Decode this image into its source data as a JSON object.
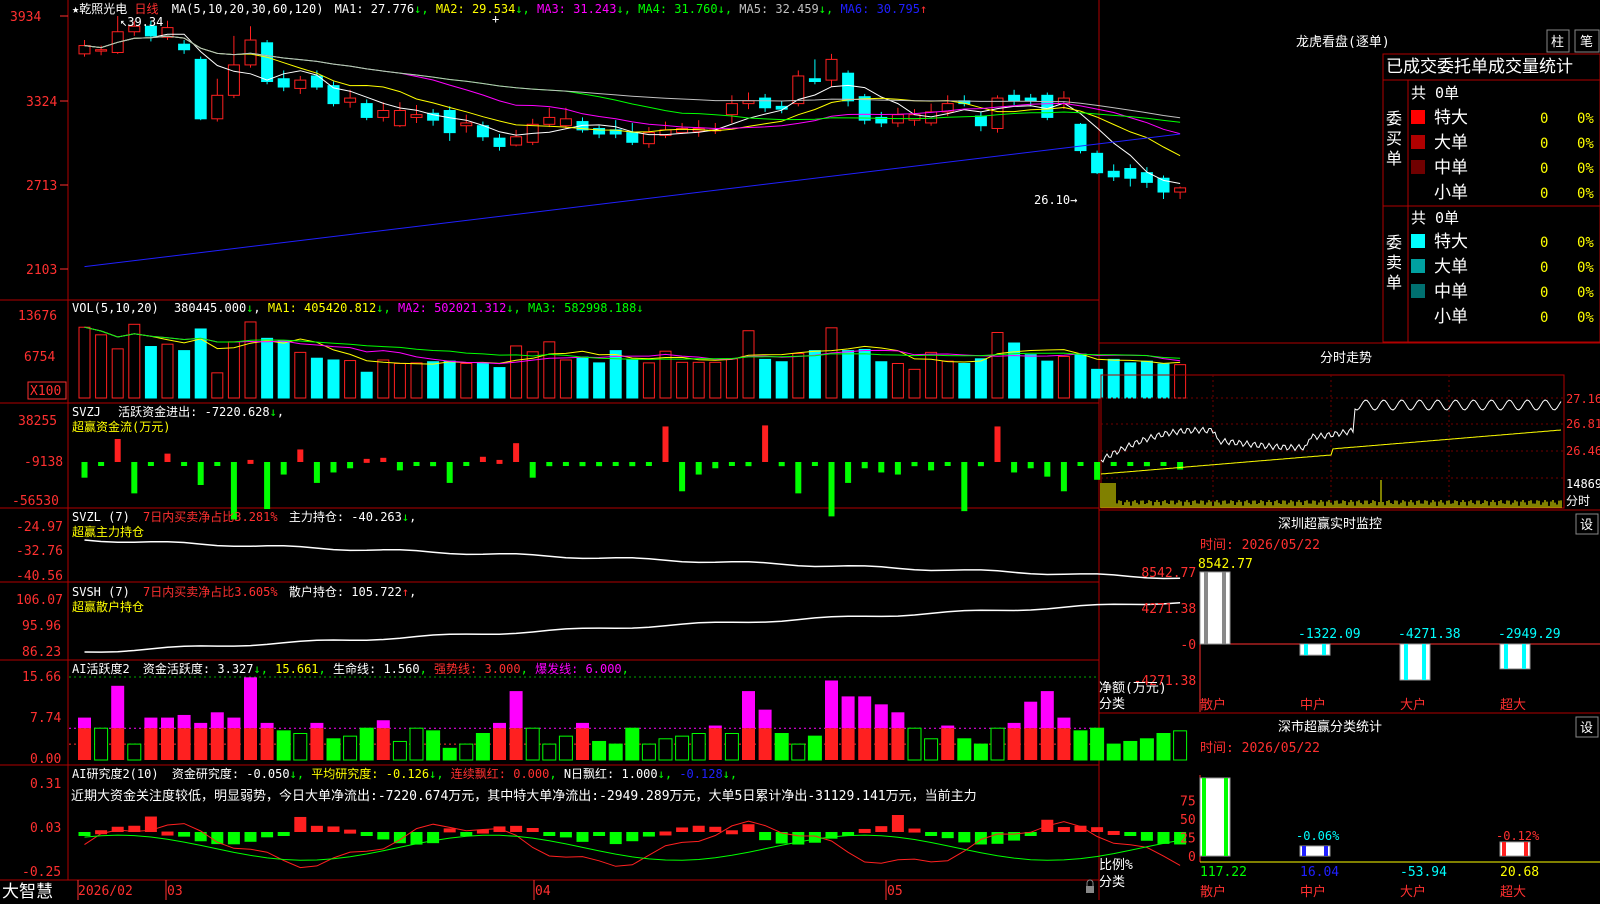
{
  "stock_title": "★乾照光电",
  "period": "日线",
  "candle_panel": {
    "ma_prefix": "MA(5,10,20,30,60,120)",
    "ma": [
      {
        "label": "MA1: 27.776",
        "arrow": "↓",
        "color": "#ffffff"
      },
      {
        "label": "MA2: 29.534",
        "arrow": "↓",
        "color": "#ffff00"
      },
      {
        "label": "MA3: 31.243",
        "arrow": "↓",
        "color": "#ff00ff"
      },
      {
        "label": "MA4: 31.760",
        "arrow": "↓",
        "color": "#00ff00"
      },
      {
        "label": "MA5: 32.459",
        "arrow": "↓",
        "color": "#c0c0c0"
      },
      {
        "label": "MA6: 30.795",
        "arrow": "↑",
        "color": "#2020ff"
      }
    ],
    "y_ticks": [
      "3934",
      "3324",
      "2713",
      "2103"
    ],
    "high_label": "39.34",
    "low_label": "26.10"
  },
  "vol_panel": {
    "title": "VOL(5,10,20)",
    "value": "380445.000",
    "ma": [
      {
        "label": "MA1: 405420.812",
        "color": "#ffff00"
      },
      {
        "label": "MA2: 502021.312",
        "color": "#ff00ff"
      },
      {
        "label": "MA3: 582998.188",
        "color": "#00ff00"
      }
    ],
    "y_ticks": [
      "13676",
      "6754"
    ],
    "unit": "X100"
  },
  "svzj_panel": {
    "title": "SVZJ",
    "label": "活跃资金进出: -7220.628",
    "subtitle": "超赢资金流(万元)",
    "y_ticks": [
      "38255",
      "-9138",
      "-56530"
    ]
  },
  "svzl_panel": {
    "title": "SVZL (7)",
    "ratio": "7日内买卖净占比3.281%",
    "label": "主力持仓: -40.263",
    "subtitle": "超赢主力持仓",
    "y_ticks": [
      "-24.97",
      "-32.76",
      "-40.56"
    ]
  },
  "svsh_panel": {
    "title": "SVSH (7)",
    "ratio": "7日内买卖净占比3.605%",
    "label": "散户持仓: 105.722",
    "subtitle": "超赢散户持仓",
    "y_ticks": [
      "106.07",
      "95.96",
      "86.23"
    ]
  },
  "ai_active_panel": {
    "title": "AI活跃度2",
    "items": [
      {
        "label": "资金活跃度: 3.327",
        "arrow": "↓",
        "color": "#ffffff"
      },
      {
        "label": "15.661",
        "arrow": "",
        "color": "#ffff00"
      },
      {
        "label": "生命线: 1.560",
        "arrow": "",
        "color": "#ffffff"
      },
      {
        "label": "强势线: 3.000",
        "arrow": "",
        "color": "#ff3030"
      },
      {
        "label": "爆发线: 6.000",
        "arrow": "",
        "color": "#ff00ff"
      }
    ],
    "y_ticks": [
      "15.66",
      "7.74",
      "0.00"
    ]
  },
  "ai_research_panel": {
    "title": "AI研究度2(10)",
    "items": [
      {
        "label": "资金研究度: -0.050",
        "arrow": "↓",
        "color": "#ffffff"
      },
      {
        "label": "平均研究度: -0.126",
        "arrow": "↓",
        "color": "#ffff00"
      },
      {
        "label": "连续飘红: 0.000",
        "arrow": "",
        "color": "#ff3030"
      },
      {
        "label": "N日飘红: 1.000",
        "arrow": "↓",
        "color": "#ffffff"
      },
      {
        "label": "-0.128",
        "arrow": "↓",
        "color": "#2020ff"
      }
    ],
    "comment": "近期大资金关注度较低，明显弱势，今日大单净流出:-7220.674万元，其中特大单净流出:-2949.289万元，大单5日累计净出-31129.141万元，当前主力",
    "y_ticks": [
      "0.31",
      "0.03",
      "-0.25"
    ]
  },
  "bottom_bar": {
    "brand": "大智慧",
    "dates": [
      "2026/02",
      "03",
      "04",
      "05"
    ]
  },
  "right": {
    "dragon": {
      "title": "龙虎看盘(逐单)",
      "tab_bar": "柱",
      "tab_single": "笔",
      "heading": "已成交委托单成交量统计",
      "buy_label": "委买单",
      "sell_label": "委卖单",
      "buy_total": "共 0单",
      "sell_total": "共 0单",
      "buy_rows": [
        {
          "name": "特大",
          "count": "0",
          "pct": "0%",
          "color": "#ff0000"
        },
        {
          "name": "大单",
          "count": "0",
          "pct": "0%",
          "color": "#b00000"
        },
        {
          "name": "中单",
          "count": "0",
          "pct": "0%",
          "color": "#700000"
        },
        {
          "name": "小单",
          "count": "0",
          "pct": "0%",
          "color": ""
        }
      ],
      "sell_rows": [
        {
          "name": "特大",
          "count": "0",
          "pct": "0%",
          "color": "#00ffff"
        },
        {
          "name": "大单",
          "count": "0",
          "pct": "0%",
          "color": "#00a0a0"
        },
        {
          "name": "中单",
          "count": "0",
          "pct": "0%",
          "color": "#007070"
        },
        {
          "name": "小单",
          "count": "0",
          "pct": "0%",
          "color": ""
        }
      ]
    },
    "intraday": {
      "title": "分时走势",
      "y_ticks": [
        "27.16",
        "26.81",
        "26.46"
      ],
      "vol_tick": "14869",
      "vol_unit": "分时"
    },
    "monitor": {
      "title": "深圳超赢实时监控",
      "settings": "设",
      "date": "时间: 2026/05/22",
      "y_ticks": [
        "8542.77",
        "4271.38",
        "-0",
        "-4271.38"
      ],
      "axis_label": "净额(万元)",
      "cat_label": "分类",
      "categories": [
        "散户",
        "中户",
        "大户",
        "超大"
      ],
      "values": [
        8542.77,
        -1322.09,
        -4271.38,
        -2949.29
      ],
      "value_labels": [
        "8542.77",
        "-1322.09",
        "-4271.38",
        "-2949.29"
      ]
    },
    "stats": {
      "title": "深市超赢分类统计",
      "settings": "设",
      "date": "时间: 2026/05/22",
      "y_ticks": [
        "75",
        "50",
        "25",
        "0"
      ],
      "axis_label": "比例%",
      "cat_label": "分类",
      "categories": [
        "散户",
        "中户",
        "大户",
        "超大"
      ],
      "values": [
        117.22,
        16.04,
        -53.94,
        20.68
      ],
      "value_labels": [
        "117.22",
        "16.04",
        "-53.94",
        "20.68"
      ],
      "top_labels": [
        "",
        "-0.06%",
        "",
        "-0.12%"
      ]
    }
  },
  "chart_data": [
    {
      "type": "candlestick",
      "title": "乾照光电 日线",
      "x": [
        "2026/02",
        "03",
        "04",
        "05"
      ],
      "ylim": [
        21.03,
        39.34
      ],
      "high": 39.34,
      "low": 26.1,
      "candles": [
        {
          "o": 36.6,
          "c": 37.2,
          "h": 37.6,
          "l": 36.4
        },
        {
          "o": 36.8,
          "c": 36.9,
          "h": 37.2,
          "l": 36.5
        },
        {
          "o": 36.7,
          "c": 38.2,
          "h": 39.34,
          "l": 36.6
        },
        {
          "o": 38.2,
          "c": 38.6,
          "h": 39.0,
          "l": 37.9
        },
        {
          "o": 38.6,
          "c": 37.9,
          "h": 39.0,
          "l": 37.5
        },
        {
          "o": 37.8,
          "c": 38.5,
          "h": 39.0,
          "l": 37.6
        },
        {
          "o": 37.3,
          "c": 36.9,
          "h": 37.6,
          "l": 36.6
        },
        {
          "o": 36.2,
          "c": 31.9,
          "h": 36.4,
          "l": 31.8
        },
        {
          "o": 31.9,
          "c": 33.6,
          "h": 34.8,
          "l": 31.7
        },
        {
          "o": 33.6,
          "c": 35.8,
          "h": 37.9,
          "l": 33.4
        },
        {
          "o": 35.8,
          "c": 37.6,
          "h": 38.6,
          "l": 35.6
        },
        {
          "o": 37.4,
          "c": 34.6,
          "h": 37.6,
          "l": 34.4
        },
        {
          "o": 34.8,
          "c": 34.2,
          "h": 35.4,
          "l": 33.9
        },
        {
          "o": 34.1,
          "c": 34.7,
          "h": 35.0,
          "l": 33.7
        },
        {
          "o": 35.0,
          "c": 34.2,
          "h": 35.4,
          "l": 34.0
        },
        {
          "o": 34.3,
          "c": 33.0,
          "h": 34.6,
          "l": 32.8
        },
        {
          "o": 33.1,
          "c": 33.4,
          "h": 34.0,
          "l": 32.7
        },
        {
          "o": 33.0,
          "c": 32.0,
          "h": 33.3,
          "l": 31.8
        },
        {
          "o": 32.0,
          "c": 32.5,
          "h": 33.1,
          "l": 31.7
        },
        {
          "o": 31.4,
          "c": 32.5,
          "h": 33.1,
          "l": 31.3
        },
        {
          "o": 32.0,
          "c": 32.2,
          "h": 32.9,
          "l": 31.6
        },
        {
          "o": 32.3,
          "c": 31.8,
          "h": 32.6,
          "l": 31.4
        },
        {
          "o": 32.5,
          "c": 30.9,
          "h": 32.8,
          "l": 30.3
        },
        {
          "o": 31.4,
          "c": 31.6,
          "h": 32.2,
          "l": 30.9
        },
        {
          "o": 31.4,
          "c": 30.6,
          "h": 31.7,
          "l": 30.3
        },
        {
          "o": 30.5,
          "c": 29.9,
          "h": 30.8,
          "l": 29.6
        },
        {
          "o": 30.0,
          "c": 30.6,
          "h": 31.1,
          "l": 29.9
        },
        {
          "o": 30.2,
          "c": 31.5,
          "h": 31.9,
          "l": 30.0
        },
        {
          "o": 31.5,
          "c": 32.0,
          "h": 32.7,
          "l": 31.3
        },
        {
          "o": 31.4,
          "c": 31.9,
          "h": 32.7,
          "l": 31.2
        },
        {
          "o": 31.7,
          "c": 31.1,
          "h": 32.0,
          "l": 30.9
        },
        {
          "o": 31.2,
          "c": 30.8,
          "h": 31.4,
          "l": 30.5
        },
        {
          "o": 31.1,
          "c": 30.8,
          "h": 31.8,
          "l": 30.5
        },
        {
          "o": 30.9,
          "c": 30.2,
          "h": 31.6,
          "l": 30.0
        },
        {
          "o": 30.1,
          "c": 30.9,
          "h": 31.3,
          "l": 29.8
        },
        {
          "o": 30.7,
          "c": 31.1,
          "h": 31.7,
          "l": 30.5
        },
        {
          "o": 30.9,
          "c": 31.2,
          "h": 31.6,
          "l": 30.8
        },
        {
          "o": 31.0,
          "c": 31.2,
          "h": 31.8,
          "l": 30.6
        },
        {
          "o": 31.1,
          "c": 31.1,
          "h": 31.6,
          "l": 30.8
        },
        {
          "o": 32.2,
          "c": 33.0,
          "h": 33.6,
          "l": 31.6
        },
        {
          "o": 33.0,
          "c": 33.2,
          "h": 33.8,
          "l": 32.6
        },
        {
          "o": 33.4,
          "c": 32.7,
          "h": 33.7,
          "l": 32.4
        },
        {
          "o": 32.8,
          "c": 32.6,
          "h": 33.2,
          "l": 32.3
        },
        {
          "o": 33.0,
          "c": 35.0,
          "h": 35.4,
          "l": 32.8
        },
        {
          "o": 34.8,
          "c": 34.6,
          "h": 36.2,
          "l": 34.4
        },
        {
          "o": 34.7,
          "c": 36.2,
          "h": 36.6,
          "l": 34.2
        },
        {
          "o": 35.2,
          "c": 33.2,
          "h": 35.4,
          "l": 32.8
        },
        {
          "o": 33.5,
          "c": 31.8,
          "h": 33.7,
          "l": 31.5
        },
        {
          "o": 32.0,
          "c": 31.6,
          "h": 32.4,
          "l": 31.3
        },
        {
          "o": 31.6,
          "c": 32.2,
          "h": 32.7,
          "l": 31.3
        },
        {
          "o": 31.8,
          "c": 32.2,
          "h": 32.6,
          "l": 31.4
        },
        {
          "o": 31.6,
          "c": 32.4,
          "h": 33.0,
          "l": 31.4
        },
        {
          "o": 32.4,
          "c": 33.0,
          "h": 33.6,
          "l": 32.1
        },
        {
          "o": 33.2,
          "c": 33.0,
          "h": 33.6,
          "l": 32.8
        },
        {
          "o": 32.1,
          "c": 31.4,
          "h": 32.4,
          "l": 31.0
        },
        {
          "o": 31.2,
          "c": 33.4,
          "h": 33.6,
          "l": 30.9
        },
        {
          "o": 33.6,
          "c": 33.2,
          "h": 34.0,
          "l": 32.9
        },
        {
          "o": 33.4,
          "c": 33.2,
          "h": 33.7,
          "l": 32.8
        },
        {
          "o": 33.6,
          "c": 32.0,
          "h": 33.8,
          "l": 31.8
        },
        {
          "o": 33.0,
          "c": 33.4,
          "h": 33.9,
          "l": 32.6
        },
        {
          "o": 31.5,
          "c": 29.6,
          "h": 31.6,
          "l": 29.4
        },
        {
          "o": 29.4,
          "c": 28.0,
          "h": 29.6,
          "l": 27.9
        },
        {
          "o": 28.1,
          "c": 27.7,
          "h": 28.6,
          "l": 27.4
        },
        {
          "o": 28.3,
          "c": 27.6,
          "h": 28.6,
          "l": 27.0
        },
        {
          "o": 28.0,
          "c": 27.3,
          "h": 28.4,
          "l": 26.9
        },
        {
          "o": 27.6,
          "c": 26.6,
          "h": 27.8,
          "l": 26.1
        },
        {
          "o": 26.6,
          "c": 26.9,
          "h": 27.0,
          "l": 26.1
        }
      ]
    },
    {
      "type": "bar",
      "title": "VOL(5,10,20)",
      "ylim": [
        0,
        13676
      ],
      "values": [
        12100,
        10800,
        8400,
        12600,
        8800,
        9200,
        8100,
        11800,
        4300,
        9600,
        13000,
        10200,
        9800,
        7800,
        6800,
        6500,
        6400,
        4400,
        6500,
        5900,
        6000,
        6200,
        6300,
        5900,
        6000,
        5200,
        8900,
        7900,
        9600,
        6500,
        7000,
        6000,
        8100,
        6500,
        6000,
        8000,
        6100,
        6100,
        6100,
        6700,
        11500,
        6600,
        6200,
        7600,
        8100,
        12000,
        8100,
        8300,
        6200,
        5900,
        4900,
        7800,
        6300,
        5900,
        6700,
        11200,
        9400,
        7400,
        6300,
        7100,
        7500,
        4900,
        6600,
        6000,
        6300,
        5800,
        5700
      ],
      "colors": "up=#ff2020 outline, down=#00ffff filled",
      "unit": "X100"
    },
    {
      "type": "bar",
      "title": "SVZJ 超赢资金流(万元)",
      "ylim": [
        -56530,
        38255
      ],
      "values": [
        -15000,
        -3000,
        22000,
        -30000,
        -3000,
        8000,
        -3000,
        -22000,
        0,
        -55000,
        2000,
        -45000,
        -12000,
        12000,
        -20000,
        -10000,
        -6000,
        3000,
        4000,
        -8000,
        -2000,
        -4000,
        -20000,
        -3000,
        5000,
        2000,
        18000,
        -15000,
        -4000,
        -3000,
        -4000,
        -4000,
        -3000,
        -4000,
        -3000,
        34000,
        -28000,
        -12000,
        -6000,
        -3000,
        -4000,
        35000,
        -4000,
        -30000,
        -3000,
        -52000,
        -20000,
        -6000,
        -10000,
        -12000,
        -4000,
        -8000,
        -3000,
        -47000,
        -4000,
        34000,
        -10000,
        -6000,
        -14000,
        -28000,
        -3000,
        -17000,
        -2000,
        -3000,
        -4000,
        -2000,
        -7200
      ]
    },
    {
      "type": "bar",
      "title": "AI活跃度2",
      "ylim": [
        0,
        15.66
      ],
      "values": [
        8.0,
        6.0,
        14.0,
        3.0,
        8.0,
        8.0,
        8.5,
        7.0,
        9.0,
        8.0,
        15.6,
        7.0,
        5.5,
        5.0,
        7.0,
        4.0,
        4.5,
        6.0,
        7.5,
        3.5,
        6.0,
        5.5,
        2.2,
        3.0,
        5.0,
        7.0,
        13.0,
        6.0,
        3.0,
        4.5,
        7.0,
        3.5,
        3.0,
        6.0,
        3.0,
        4.0,
        4.5,
        5.0,
        6.5,
        5.0,
        13.0,
        9.5,
        5.0,
        3.0,
        4.5,
        15.0,
        12.0,
        12.0,
        10.5,
        9.0,
        6.0,
        4.0,
        6.5,
        4.0,
        3.0,
        6.0,
        7.0,
        11.0,
        13.0,
        8.0,
        5.5,
        6.0,
        3.0,
        3.5,
        4.0,
        5.0,
        5.5,
        3.3
      ],
      "lines": {
        "强势线": 3.0,
        "爆发线": 6.0,
        "生命线": 1.56
      }
    },
    {
      "type": "bar",
      "title": "深圳超赢实时监控",
      "categories": [
        "散户",
        "中户",
        "大户",
        "超大"
      ],
      "values": [
        8542.77,
        -1322.09,
        -4271.38,
        -2949.29
      ],
      "ylabel": "净额(万元)"
    },
    {
      "type": "bar",
      "title": "深市超赢分类统计",
      "categories": [
        "散户",
        "中户",
        "大户",
        "超大"
      ],
      "values": [
        117.22,
        16.04,
        -53.94,
        20.68
      ],
      "ylabel": "比例%"
    }
  ]
}
